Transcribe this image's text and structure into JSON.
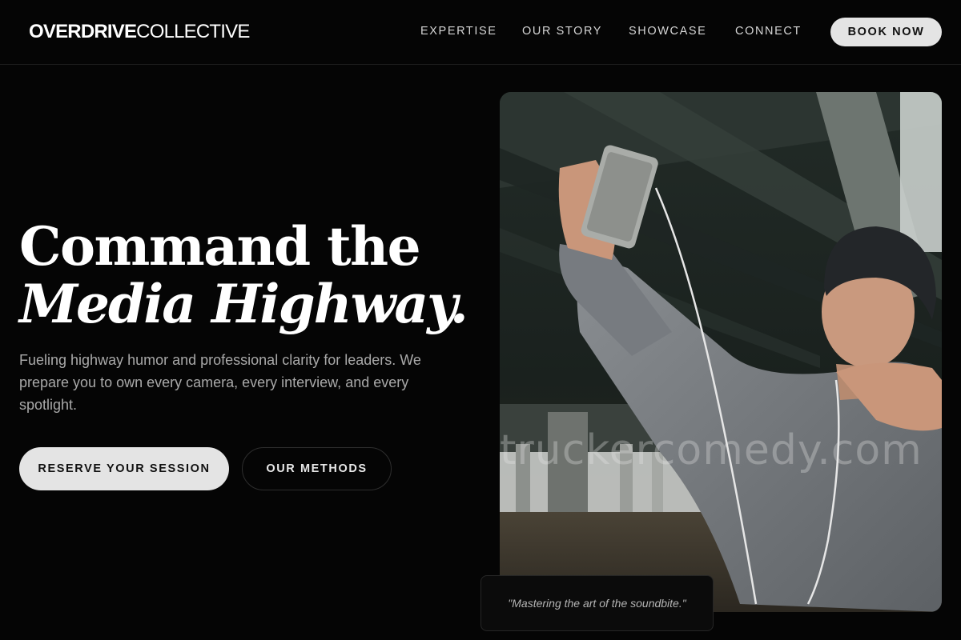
{
  "brand": {
    "part1": "OVERDRIVE",
    "part2": "COLLECTIVE"
  },
  "nav": {
    "items": [
      {
        "label": "EXPERTISE"
      },
      {
        "label": "OUR STORY"
      },
      {
        "label": "SHOWCASE"
      },
      {
        "label": "CONNECT"
      }
    ],
    "cta_label": "BOOK NOW"
  },
  "hero": {
    "title_line1": "Command the",
    "title_line2": "Media Highway.",
    "subtitle": "Fueling highway humor and professional clarity for leaders. We prepare you to own every camera, every interview, and every spotlight.",
    "primary_cta": "RESERVE YOUR SESSION",
    "secondary_cta": "OUR METHODS"
  },
  "image": {
    "watermark": "truckercomedy.com"
  },
  "quote": {
    "text": "\"Mastering the art of the soundbite.\""
  },
  "colors": {
    "background": "#050505",
    "button_light": "#e4e4e4",
    "text_primary": "#ffffff",
    "text_muted": "#a9a9a9"
  }
}
